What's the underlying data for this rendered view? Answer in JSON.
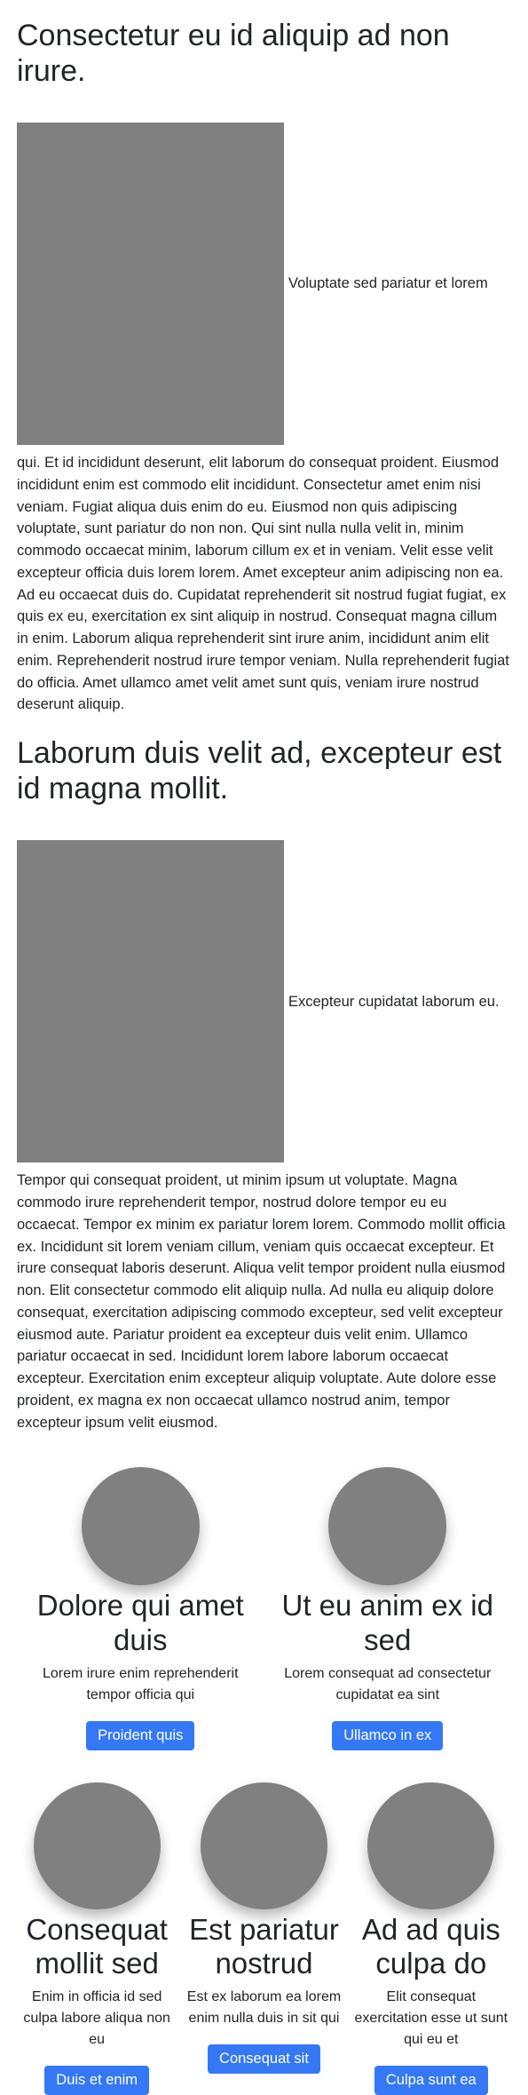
{
  "section1": {
    "title": "Consectetur eu id aliquip ad non irure.",
    "inline_text": "Voluptate sed pariatur et lorem",
    "body": "qui. Et id incididunt deserunt, elit laborum do consequat proident. Eiusmod incididunt enim est commodo elit incididunt. Consectetur amet enim nisi veniam. Fugiat aliqua duis enim do eu. Eiusmod non quis adipiscing voluptate, sunt pariatur do non non. Qui sint nulla nulla velit in, minim commodo occaecat minim, laborum cillum ex et in veniam. Velit esse velit excepteur officia duis lorem lorem. Amet excepteur anim adipiscing non ea. Ad eu occaecat duis do. Cupidatat reprehenderit sit nostrud fugiat fugiat, ex quis ex eu, exercitation ex sint aliquip in nostrud. Consequat magna cillum in enim. Laborum aliqua reprehenderit sint irure anim, incididunt anim elit enim. Reprehenderit nostrud irure tempor veniam. Nulla reprehenderit fugiat do officia. Amet ullamco amet velit amet sunt quis, veniam irure nostrud deserunt aliquip."
  },
  "section2": {
    "title": "Laborum duis velit ad, excepteur est id magna mollit.",
    "inline_text": "Excepteur cupidatat laborum eu.",
    "body": "Tempor qui consequat proident, ut minim ipsum ut voluptate. Magna commodo irure reprehenderit tempor, nostrud dolore tempor eu eu occaecat. Tempor ex minim ex pariatur lorem lorem. Commodo mollit officia ex. Incididunt sit lorem veniam cillum, veniam quis occaecat excepteur. Et irure consequat laboris deserunt. Aliqua velit tempor proident nulla eiusmod non. Elit consectetur commodo elit aliquip nulla. Ad nulla eu aliquip dolore consequat, exercitation adipiscing commodo excepteur, sed velit excepteur eiusmod aute. Pariatur proident ea excepteur duis velit enim. Ullamco pariatur occaecat in sed. Incididunt lorem labore laborum occaecat excepteur. Exercitation enim excepteur aliquip voluptate. Aute dolore esse proident, ex magna ex non occaecat ullamco nostrud anim, tempor excepteur ipsum velit eiusmod."
  },
  "cards_row1": [
    {
      "title": "Dolore qui amet duis",
      "text": "Lorem irure enim reprehenderit tempor officia qui",
      "button": "Proident quis"
    },
    {
      "title": "Ut eu anim ex id sed",
      "text": "Lorem consequat ad consectetur cupidatat ea sint",
      "button": "Ullamco in ex"
    }
  ],
  "cards_row2": [
    {
      "title": "Consequat mollit sed",
      "text": "Enim in officia id sed culpa labore aliqua non eu",
      "button": "Duis et enim"
    },
    {
      "title": "Est pariatur nostrud",
      "text": "Est ex laborum ea lorem enim nulla duis in sit qui",
      "button": "Consequat sit"
    },
    {
      "title": "Ad ad quis culpa do",
      "text": "Elit consequat exercitation esse ut sunt qui eu et",
      "button": "Culpa sunt ea"
    }
  ],
  "colors": {
    "button_bg": "#3478f6",
    "placeholder": "#808080",
    "text": "#212529"
  }
}
